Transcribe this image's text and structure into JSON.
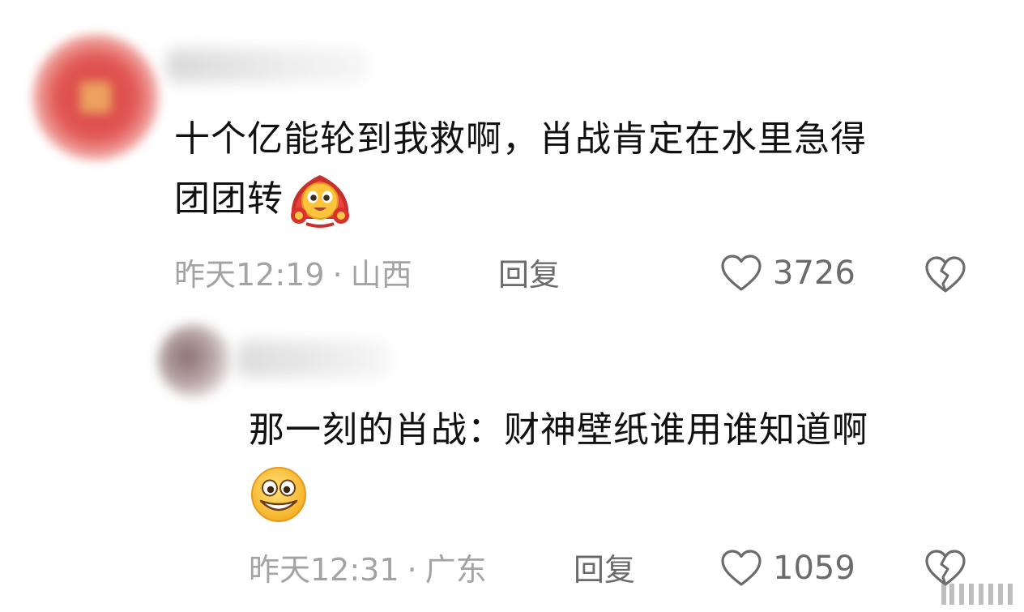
{
  "comments": [
    {
      "text_line1": "十个亿能轮到我救啊，肖战肯定在水里急得",
      "text_line2": "团团转",
      "time": "昨天12:19",
      "separator": "·",
      "location": "山西",
      "reply_label": "回复",
      "like_count": "3726",
      "emoji": "fortune-emoji-icon"
    },
    {
      "text_line1": "那一刻的肖战：财神壁纸谁用谁知道啊",
      "time": "昨天12:31",
      "separator": "·",
      "location": "广东",
      "reply_label": "回复",
      "like_count": "1059",
      "emoji": "grinning-emoji-icon"
    }
  ],
  "icons": {
    "like": "heart-outline-icon",
    "dislike": "broken-heart-icon"
  },
  "colors": {
    "text": "#111111",
    "meta": "#a3a3a3",
    "action": "#6b6b6b"
  }
}
